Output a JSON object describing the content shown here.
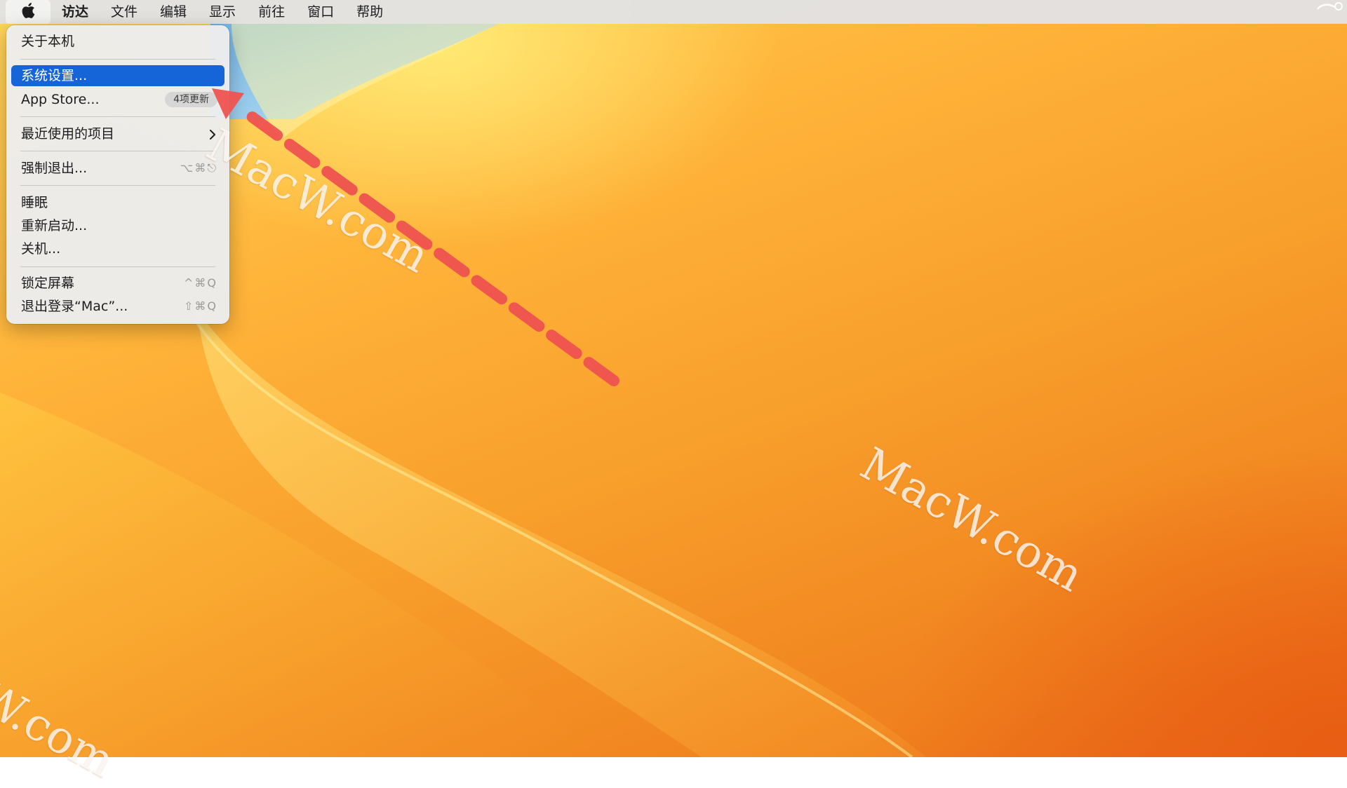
{
  "menubar": {
    "apple_icon": "apple-logo-icon",
    "items": [
      "访达",
      "文件",
      "编辑",
      "显示",
      "前往",
      "窗口",
      "帮助"
    ]
  },
  "apple_menu": {
    "about": "关于本机",
    "system_settings": "系统设置...",
    "app_store": "App Store...",
    "app_store_badge": "4项更新",
    "recent_items": "最近使用的项目",
    "force_quit": "强制退出...",
    "force_quit_shortcut": "⌥⌘⎋",
    "sleep": "睡眠",
    "restart": "重新启动...",
    "shut_down": "关机...",
    "lock_screen": "锁定屏幕",
    "lock_screen_shortcut": "^⌘Q",
    "log_out": "退出登录“Mac”...",
    "log_out_shortcut": "⇧⌘Q"
  },
  "watermarks": [
    "MacW.com",
    "MacW.com",
    "cW.com"
  ],
  "colors": {
    "selection": "#1665d8",
    "annotation_arrow": "#ef5350",
    "wallpaper_top": "#ffd65a",
    "wallpaper_bottom": "#e8681a"
  }
}
